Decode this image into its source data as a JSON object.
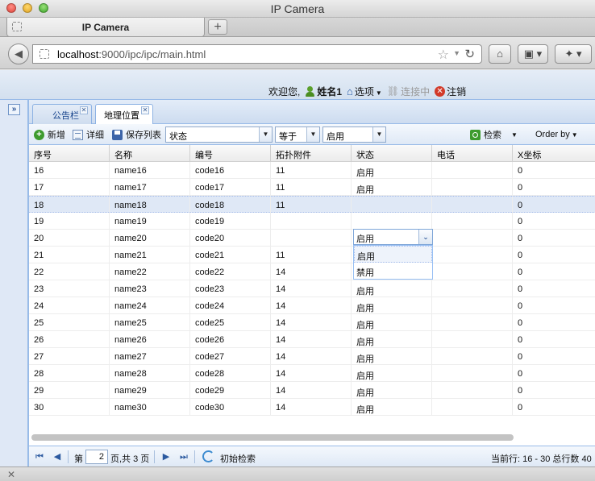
{
  "window": {
    "title": "IP Camera"
  },
  "browser_tab": {
    "title": "IP Camera",
    "new_tab_label": "+"
  },
  "address": {
    "host": "localhost",
    "path": ":9000/ipc/ipc/main.html"
  },
  "header": {
    "welcome": "欢迎您,",
    "username": "姓名1",
    "options": "选项",
    "connecting": "连接中",
    "logout": "注销"
  },
  "tabs": [
    {
      "label": "公告栏",
      "active": false
    },
    {
      "label": "地理位置",
      "active": true
    }
  ],
  "toolbar": {
    "add": "新增",
    "detail": "详细",
    "save_list": "保存列表",
    "filter_field": "状态",
    "filter_op": "等于",
    "filter_value": "启用",
    "search": "检索",
    "order_by": "Order by"
  },
  "grid": {
    "columns": [
      "序号",
      "名称",
      "编号",
      "拓扑附件",
      "状态",
      "电话",
      "X坐标"
    ],
    "rows": [
      [
        "16",
        "name16",
        "code16",
        "11",
        "启用",
        "",
        "0"
      ],
      [
        "17",
        "name17",
        "code17",
        "11",
        "启用",
        "",
        "0"
      ],
      [
        "18",
        "name18",
        "code18",
        "11",
        "",
        "",
        "0"
      ],
      [
        "19",
        "name19",
        "code19",
        "",
        "",
        "",
        "0"
      ],
      [
        "20",
        "name20",
        "code20",
        "",
        "",
        "",
        "0"
      ],
      [
        "21",
        "name21",
        "code21",
        "11",
        "启用",
        "",
        "0"
      ],
      [
        "22",
        "name22",
        "code22",
        "14",
        "启用",
        "",
        "0"
      ],
      [
        "23",
        "name23",
        "code23",
        "14",
        "启用",
        "",
        "0"
      ],
      [
        "24",
        "name24",
        "code24",
        "14",
        "启用",
        "",
        "0"
      ],
      [
        "25",
        "name25",
        "code25",
        "14",
        "启用",
        "",
        "0"
      ],
      [
        "26",
        "name26",
        "code26",
        "14",
        "启用",
        "",
        "0"
      ],
      [
        "27",
        "name27",
        "code27",
        "14",
        "启用",
        "",
        "0"
      ],
      [
        "28",
        "name28",
        "code28",
        "14",
        "启用",
        "",
        "0"
      ],
      [
        "29",
        "name29",
        "code29",
        "14",
        "启用",
        "",
        "0"
      ],
      [
        "30",
        "name30",
        "code30",
        "14",
        "启用",
        "",
        "0"
      ]
    ],
    "selected_row": 2,
    "editor_value": "启用",
    "dropdown_options": [
      "启用",
      "禁用"
    ]
  },
  "pager": {
    "page_prefix": "第",
    "page_value": "2",
    "page_suffix": "页,共 3 页",
    "reset_search": "初始检索",
    "info": "当前行: 16 - 30 总行数 40"
  }
}
